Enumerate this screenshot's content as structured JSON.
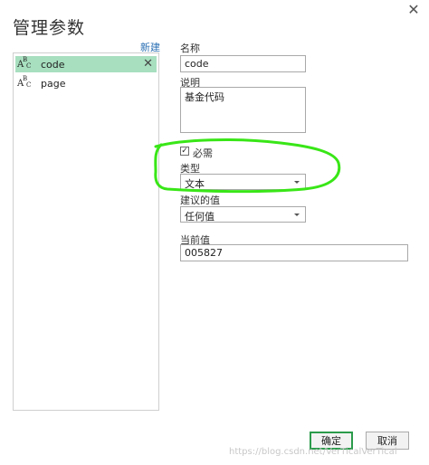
{
  "dialog": {
    "title": "管理参数",
    "close_glyph": "✕"
  },
  "param_list": {
    "new_label": "新建",
    "items": [
      {
        "name": "code",
        "selected": true
      },
      {
        "name": "page",
        "selected": false
      }
    ],
    "item_close_glyph": "✕",
    "type_icon": "abc-text-type-icon"
  },
  "form": {
    "name_label": "名称",
    "name_value": "code",
    "description_label": "说明",
    "description_value": "基金代码",
    "required_label": "必需",
    "required_checked": true,
    "type_label": "类型",
    "type_value": "文本",
    "suggested_label": "建议的值",
    "suggested_value": "任何值",
    "current_label": "当前值",
    "current_value": "005827"
  },
  "buttons": {
    "ok": "确定",
    "cancel": "取消"
  },
  "watermark": "https://blog.csdn.net/VerTicalVerTical",
  "colors": {
    "selected_row": "#a7dfbf",
    "annotation": "#39e617",
    "primary_border": "#2b9b4b"
  }
}
